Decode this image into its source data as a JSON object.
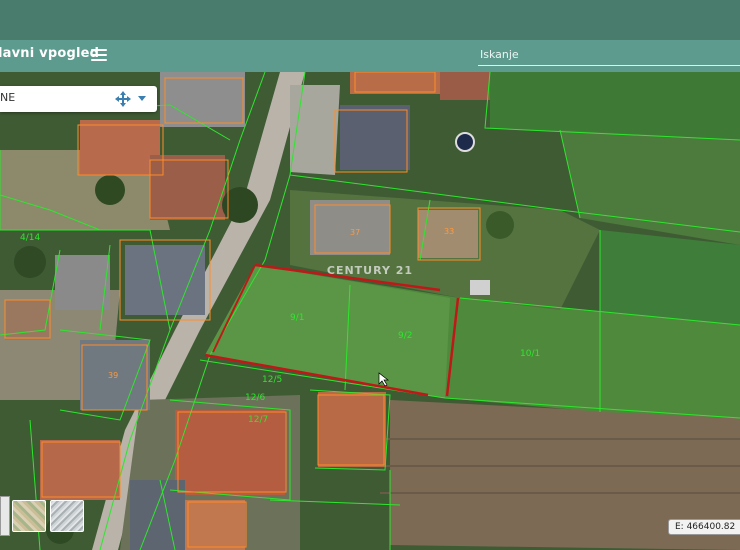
{
  "header": {
    "title": "lavni vpogled",
    "search_placeholder": "Iskanje"
  },
  "layer_panel": {
    "label": "NE"
  },
  "map": {
    "watermark": "CENTURY 21",
    "parcel_labels": [
      "9/1",
      "9/2",
      "10/1",
      "4/14",
      "12/6",
      "12/7",
      "12/5"
    ],
    "building_labels": [
      "39",
      "37",
      "33"
    ],
    "coordinate": "E: 466400.82"
  },
  "colors": {
    "parcel_line": "#2ee62e",
    "building_line": "#ff8c2a",
    "highlight": "#c01818"
  },
  "icons": {
    "menu": "hamburger-icon",
    "move": "move-icon",
    "dropdown": "chevron-down-icon"
  }
}
